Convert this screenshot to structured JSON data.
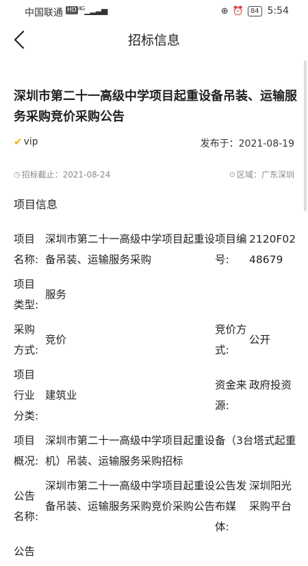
{
  "status_bar": {
    "carrier": "中国联通",
    "hd": "HD",
    "network": "4G",
    "battery": "84",
    "time": "5:54"
  },
  "nav": {
    "title": "招标信息"
  },
  "article": {
    "title": "深圳市第二十一高级中学项目起重设备吊装、运输服务采购竞价采购公告",
    "vip_label": "vip",
    "published": "发布于：2021-08-19",
    "deadline": "招标截止：2021-08-24",
    "region": "区域：广东深圳"
  },
  "section_title": "项目信息",
  "info": {
    "r1": {
      "k1": "项目名称:",
      "v1": "深圳市第二十一高级中学项目起重设备吊装、运输服务采购",
      "k2": "项目编号:",
      "v2": "2120F0248679"
    },
    "r2": {
      "k1": "项目类型:",
      "v1": "服务"
    },
    "r3": {
      "k1": "采购方式:",
      "v1": "竞价",
      "k2": "竞价方式:",
      "v2": "公开"
    },
    "r4": {
      "k1": "项目行业分类:",
      "v1": "建筑业",
      "k2": "资金来源:",
      "v2": "政府投资"
    },
    "r5": {
      "k1": "项目概况:",
      "v1": "深圳市第二十一高级中学项目起重设备（3台塔式起重机）吊装、运输服务采购招标"
    },
    "r6": {
      "k1": "公告名称:",
      "v1": "深圳市第二十一高级中学项目起重设备吊装、运输服务采购竞价采购公告",
      "k2": "公告发布媒体:",
      "v2": "深圳阳光采购平台"
    },
    "r7": {
      "k1": "公告"
    }
  }
}
